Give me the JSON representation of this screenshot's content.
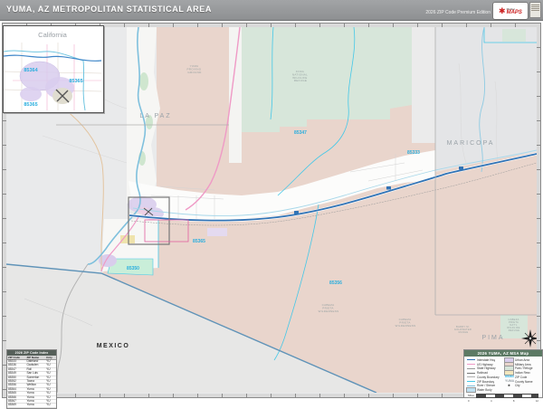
{
  "header": {
    "title": "YUMA, AZ METROPOLITAN STATISTICAL AREA",
    "edition": "2026 ZIP Code Premium Edition",
    "logo": {
      "market": "Market",
      "maps": "MAPS",
      "star": "✱"
    }
  },
  "inset": {
    "state_label": "California",
    "zips": [
      "85364",
      "85365",
      "85365"
    ]
  },
  "map": {
    "country": "MEXICO",
    "counties": [
      "LA PAZ",
      "MARICOPA",
      "PIMA"
    ],
    "zips": [
      "85347",
      "85333",
      "85365",
      "85356",
      "85350"
    ],
    "features": {
      "yuma_pg": [
        "YUMA",
        "PROVING",
        "GROUND"
      ],
      "kofa": [
        "KOFA",
        "NATIONAL",
        "WILDLIFE",
        "REFUGE"
      ],
      "cabeza1": [
        "CABEZA",
        "PRIETA",
        "WILDERNESS"
      ],
      "cabeza2": [
        "CABEZA",
        "PRIETA",
        "WILDERNESS"
      ],
      "cabeza_nwr": [
        "CABEZA",
        "PRIETA",
        "NAT'L",
        "WILDLIFE",
        "REFUGE"
      ],
      "goldwater": [
        "BARRY M.",
        "GOLDWATER",
        "RANGE"
      ]
    }
  },
  "colors": {
    "desert_tan": "#e9d5cc",
    "refuge_green": "#d7e6da",
    "urban_purple": "#d9cdec",
    "zip_label_blue": "#29aede",
    "zip_boundary_cyan": "#45c8e8",
    "interstate_blue": "#3173b5",
    "us_hwy_pink": "#ef9ac6",
    "county_gray": "#b0b0b0"
  },
  "zip_table": {
    "title": "2026 ZIP Code Index",
    "columns": [
      "ZIP Code",
      "ZIP Name",
      "Cnty"
    ],
    "rows": [
      [
        "85333",
        "Dateland",
        "YU"
      ],
      [
        "85336",
        "Gadsden",
        "YU"
      ],
      [
        "85347",
        "Roll",
        "YU"
      ],
      [
        "85349",
        "San Luis",
        "YU"
      ],
      [
        "85350",
        "Somerton",
        "YU"
      ],
      [
        "85352",
        "Tacna",
        "YU"
      ],
      [
        "85356",
        "Wellton",
        "YU"
      ],
      [
        "85364",
        "Yuma",
        "YU"
      ],
      [
        "85365",
        "Yuma",
        "YU"
      ],
      [
        "85366",
        "Yuma",
        "YU"
      ],
      [
        "85367",
        "Yuma",
        "YU"
      ],
      [
        "85369",
        "Yuma",
        "YU"
      ]
    ]
  },
  "legend": {
    "title": "2026 YUMA, AZ MSA Map",
    "left": [
      {
        "label": "Interstate Hwy",
        "type": "line",
        "color": "#3173b5"
      },
      {
        "label": "US Highway",
        "type": "line",
        "color": "#ef9ac6"
      },
      {
        "label": "State Highway",
        "type": "line",
        "color": "#999999"
      },
      {
        "label": "Railroad",
        "type": "line",
        "color": "#777777"
      },
      {
        "label": "County Boundary",
        "type": "line",
        "color": "#b0b0b0"
      },
      {
        "label": "ZIP Boundary",
        "type": "line",
        "color": "#45c8e8"
      },
      {
        "label": "River / Stream",
        "type": "line",
        "color": "#7fc0dd"
      },
      {
        "label": "Water Body",
        "type": "fill",
        "color": "#bfe0f0"
      }
    ],
    "right": [
      {
        "label": "Urban Area",
        "type": "fill",
        "color": "#d9cdec"
      },
      {
        "label": "Military Area",
        "type": "fill",
        "color": "#e9d5cc"
      },
      {
        "label": "Park / Refuge",
        "type": "fill",
        "color": "#d7e6da"
      },
      {
        "label": "Indian Resv.",
        "type": "fill",
        "color": "#f3e6bc"
      },
      {
        "label": "ZIP Code",
        "type": "glyph",
        "color": "#29aede",
        "glyph": "85364"
      },
      {
        "label": "County Name",
        "type": "glyph",
        "color": "#9aa2a8",
        "glyph": "YUMA"
      },
      {
        "label": "City",
        "type": "glyph",
        "color": "#333333",
        "glyph": "★"
      }
    ],
    "scale": {
      "ticks": [
        "0",
        "4",
        "8",
        "12"
      ],
      "units": "Miles"
    }
  }
}
